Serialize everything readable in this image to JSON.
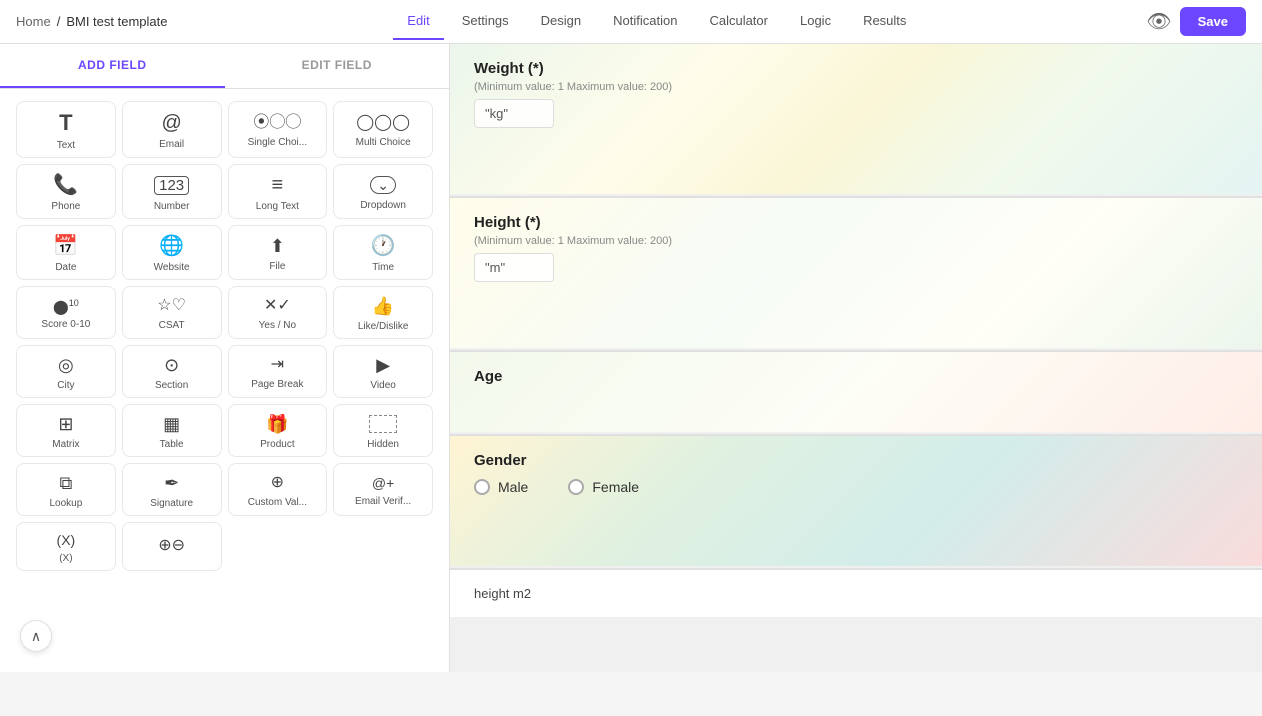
{
  "breadcrumb": {
    "home": "Home",
    "separator": "/",
    "current": "BMI test template"
  },
  "nav": {
    "tabs": [
      {
        "label": "Edit",
        "active": true
      },
      {
        "label": "Settings",
        "active": false
      },
      {
        "label": "Design",
        "active": false
      },
      {
        "label": "Notification",
        "active": false
      },
      {
        "label": "Calculator",
        "active": false
      },
      {
        "label": "Logic",
        "active": false
      },
      {
        "label": "Results",
        "active": false
      }
    ],
    "save_label": "Save"
  },
  "left_panel": {
    "tabs": [
      "ADD FIELD",
      "EDIT FIELD"
    ],
    "active_tab": 0,
    "fields": [
      {
        "name": "Text",
        "icon": "T"
      },
      {
        "name": "Email",
        "icon": "@"
      },
      {
        "name": "Single Choi...",
        "icon": "⦿⦿⦿"
      },
      {
        "name": "Multi Choice",
        "icon": "⊙⊙⊙"
      },
      {
        "name": "Phone",
        "icon": "📞"
      },
      {
        "name": "Number",
        "icon": "123"
      },
      {
        "name": "Long Text",
        "icon": "≡"
      },
      {
        "name": "Dropdown",
        "icon": "⊡▾"
      },
      {
        "name": "Date",
        "icon": "📅"
      },
      {
        "name": "Website",
        "icon": "🌐"
      },
      {
        "name": "File",
        "icon": "↑□"
      },
      {
        "name": "Time",
        "icon": "🕐"
      },
      {
        "name": "Score 0-10",
        "icon": "●"
      },
      {
        "name": "CSAT",
        "icon": "☆♡"
      },
      {
        "name": "Yes / No",
        "icon": "✕✓"
      },
      {
        "name": "Like/Dislike",
        "icon": "👍"
      },
      {
        "name": "City",
        "icon": "◎"
      },
      {
        "name": "Section",
        "icon": "⊙"
      },
      {
        "name": "Page Break",
        "icon": "⇥"
      },
      {
        "name": "Video",
        "icon": "▶"
      },
      {
        "name": "Matrix",
        "icon": "⊞"
      },
      {
        "name": "Table",
        "icon": "▦"
      },
      {
        "name": "Product",
        "icon": "🎁"
      },
      {
        "name": "Hidden",
        "icon": "⬚"
      },
      {
        "name": "Lookup",
        "icon": "⧉"
      },
      {
        "name": "Signature",
        "icon": "✒"
      },
      {
        "name": "Custom Val...",
        "icon": "⊕"
      },
      {
        "name": "Email Verif...",
        "icon": "@+"
      },
      {
        "name": "(X)",
        "icon": "(X)"
      },
      {
        "name": "⊕",
        "icon": "⊕⊖"
      }
    ]
  },
  "form": {
    "sections": [
      {
        "id": "weight",
        "title": "Weight (*)",
        "desc": "(Minimum value: 1 Maximum value: 200)",
        "placeholder": "\"kg\"",
        "has_input": true
      },
      {
        "id": "height",
        "title": "Height (*)",
        "desc": "(Minimum value: 1 Maximum value: 200)",
        "placeholder": "\"m\"",
        "has_input": true
      },
      {
        "id": "age",
        "title": "Age",
        "desc": "",
        "placeholder": "",
        "has_input": false
      },
      {
        "id": "gender",
        "title": "Gender",
        "desc": "",
        "placeholder": "",
        "has_input": false,
        "is_gender": true,
        "options": [
          "Male",
          "Female"
        ]
      }
    ],
    "bottom_label": "height m2"
  },
  "scroll_btn": "∧"
}
